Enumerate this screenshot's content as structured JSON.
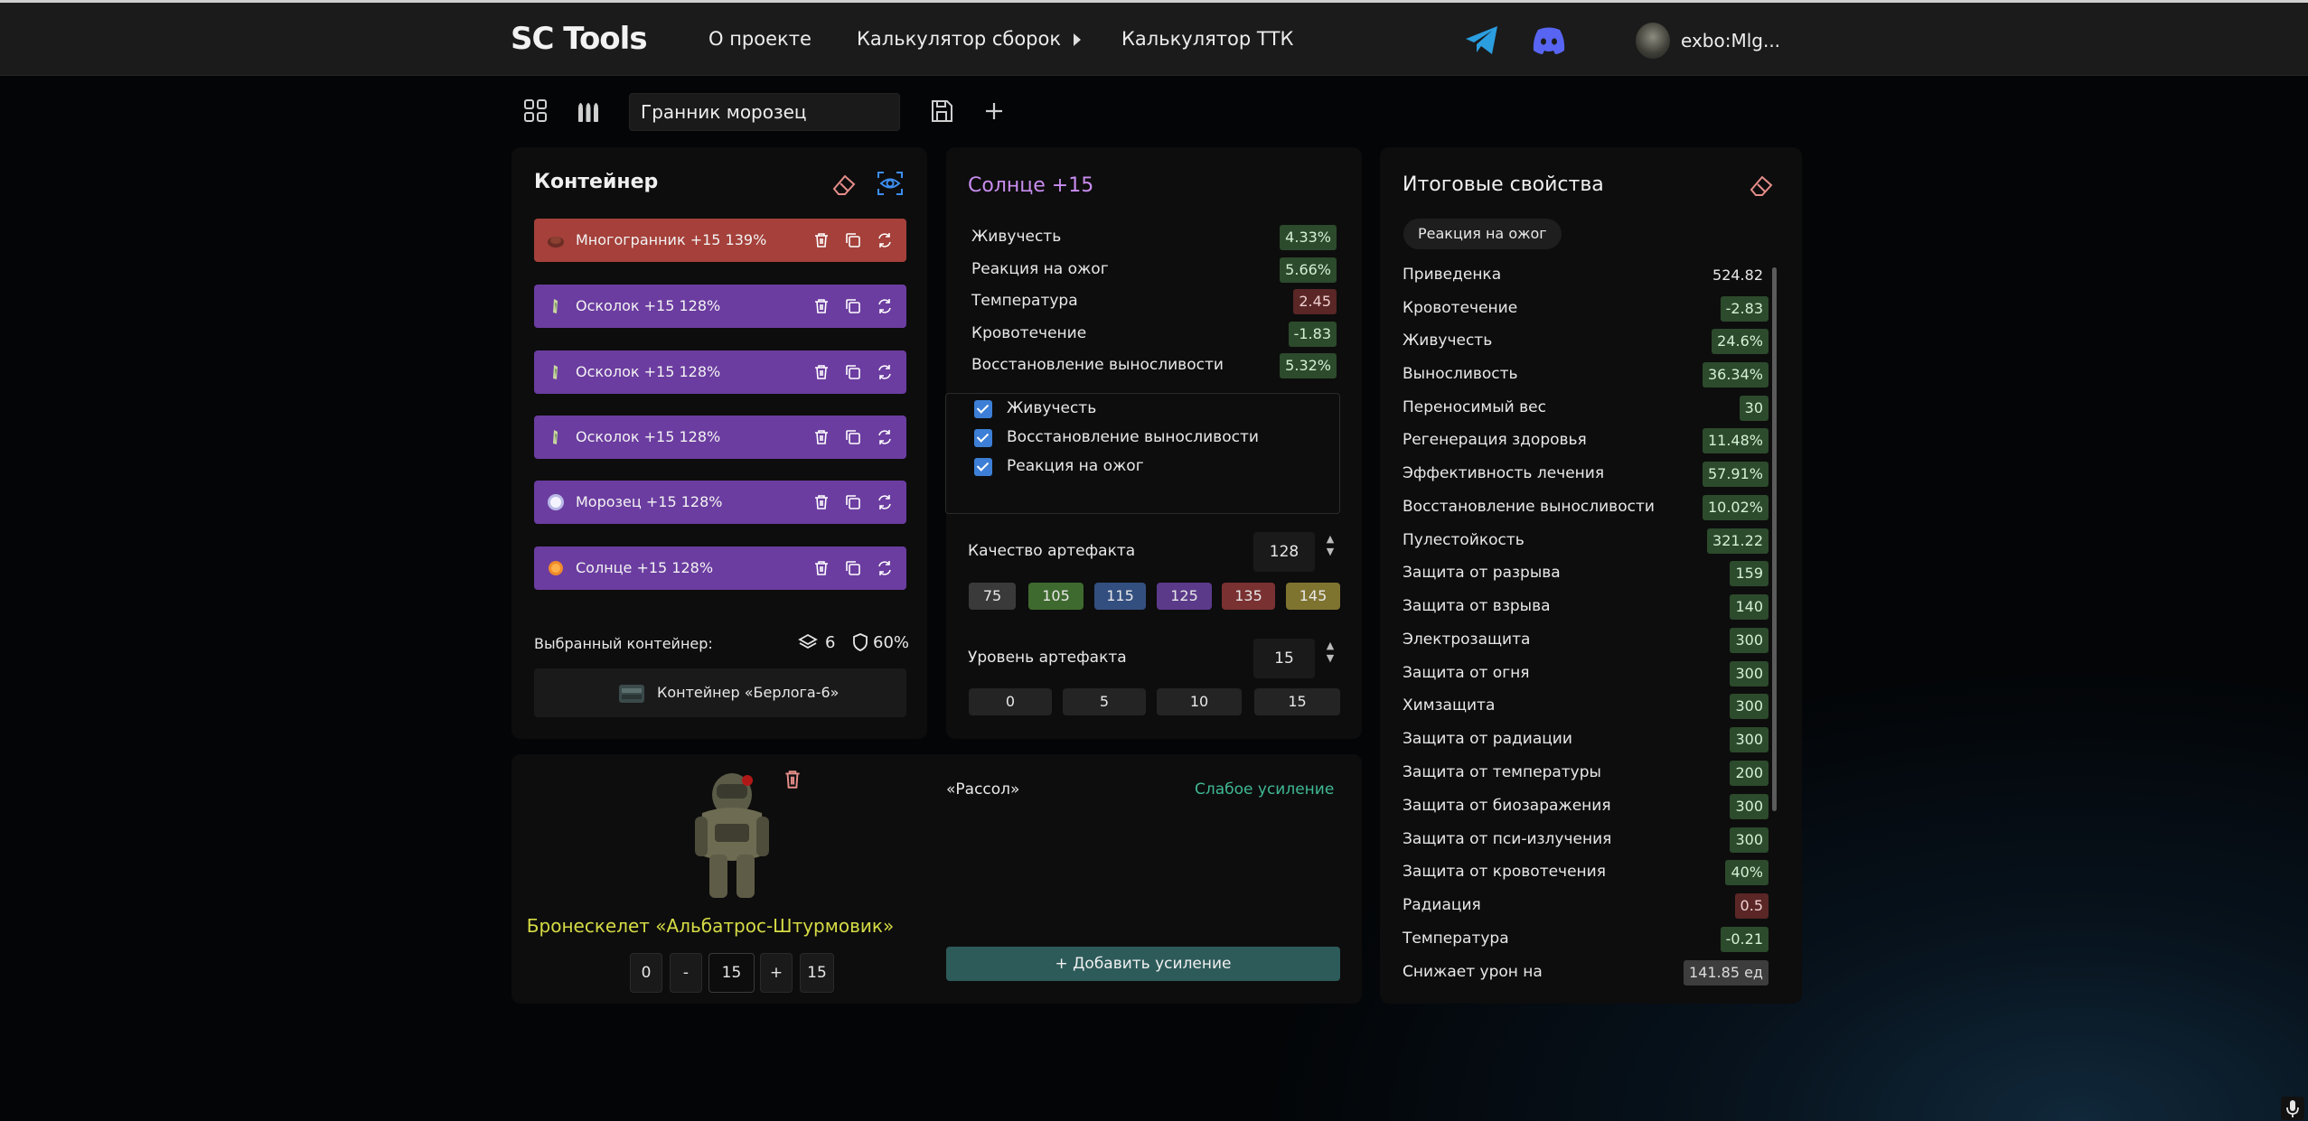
{
  "header": {
    "logo": "SC Tools",
    "nav": [
      "О проекте",
      "Калькулятор сборок",
      "Калькулятор ТТК"
    ],
    "user_name": "exbo:Mlg..."
  },
  "toolbar": {
    "build_name": "Гранник морозец"
  },
  "container_panel": {
    "title": "Контейнер",
    "items": [
      {
        "label": "Многогранник +15 139%",
        "color": "#a5403a",
        "icon": "polyhedron-artifact-icon"
      },
      {
        "label": "Осколок +15 128%",
        "color": "#6b3da0",
        "icon": "shard-artifact-icon"
      },
      {
        "label": "Осколок +15 128%",
        "color": "#6b3da0",
        "icon": "shard-artifact-icon"
      },
      {
        "label": "Осколок +15 128%",
        "color": "#6b3da0",
        "icon": "shard-artifact-icon"
      },
      {
        "label": "Морозец +15 128%",
        "color": "#6b3da0",
        "icon": "frost-artifact-icon"
      },
      {
        "label": "Солнце +15 128%",
        "color": "#6b3da0",
        "icon": "sun-artifact-icon"
      }
    ],
    "selected_label": "Выбранный контейнер:",
    "slots": "6",
    "protection": "60%",
    "container_name": "Контейнер «Берлога-6»"
  },
  "artifact_panel": {
    "title": "Солнце +15",
    "stats": [
      {
        "name": "Живучесть",
        "value": "4.33%",
        "tone": "green"
      },
      {
        "name": "Реакция на ожог",
        "value": "5.66%",
        "tone": "green"
      },
      {
        "name": "Температура",
        "value": "2.45",
        "tone": "red"
      },
      {
        "name": "Кровотечение",
        "value": "-1.83",
        "tone": "green"
      },
      {
        "name": "Восстановление выносливости",
        "value": "5.32%",
        "tone": "green"
      }
    ],
    "checkboxes": [
      "Живучесть",
      "Восстановление выносливости",
      "Реакция на ожог"
    ],
    "quality_label": "Качество артефакта",
    "quality_value": "128",
    "quality_presets": [
      {
        "label": "75",
        "color": "#3a3a3a"
      },
      {
        "label": "105",
        "color": "#3f6a2f"
      },
      {
        "label": "115",
        "color": "#334f80"
      },
      {
        "label": "125",
        "color": "#5b3a8a"
      },
      {
        "label": "135",
        "color": "#7a3131"
      },
      {
        "label": "145",
        "color": "#7f7330"
      }
    ],
    "level_label": "Уровень артефакта",
    "level_value": "15",
    "level_presets": [
      "0",
      "5",
      "10",
      "15"
    ]
  },
  "totals_panel": {
    "title": "Итоговые свойства",
    "filter_chip": "Реакция на ожог",
    "props": [
      {
        "name": "Приведенка",
        "value": "524.82",
        "tone": "plain"
      },
      {
        "name": "Кровотечение",
        "value": "-2.83",
        "tone": "green"
      },
      {
        "name": "Живучесть",
        "value": "24.6%",
        "tone": "green"
      },
      {
        "name": "Выносливость",
        "value": "36.34%",
        "tone": "green"
      },
      {
        "name": "Переносимый вес",
        "value": "30",
        "tone": "green"
      },
      {
        "name": "Регенерация здоровья",
        "value": "11.48%",
        "tone": "green"
      },
      {
        "name": "Эффективность лечения",
        "value": "57.91%",
        "tone": "green"
      },
      {
        "name": "Восстановление выносливости",
        "value": "10.02%",
        "tone": "green"
      },
      {
        "name": "Пулестойкость",
        "value": "321.22",
        "tone": "green"
      },
      {
        "name": "Защита от разрыва",
        "value": "159",
        "tone": "green"
      },
      {
        "name": "Защита от взрыва",
        "value": "140",
        "tone": "green"
      },
      {
        "name": "Электрозащита",
        "value": "300",
        "tone": "green"
      },
      {
        "name": "Защита от огня",
        "value": "300",
        "tone": "green"
      },
      {
        "name": "Химзащита",
        "value": "300",
        "tone": "green"
      },
      {
        "name": "Защита от радиации",
        "value": "300",
        "tone": "green"
      },
      {
        "name": "Защита от температуры",
        "value": "200",
        "tone": "green"
      },
      {
        "name": "Защита от биозаражения",
        "value": "300",
        "tone": "green"
      },
      {
        "name": "Защита от пси-излучения",
        "value": "300",
        "tone": "green"
      },
      {
        "name": "Защита от кровотечения",
        "value": "40%",
        "tone": "green"
      },
      {
        "name": "Радиация",
        "value": "0.5",
        "tone": "red"
      },
      {
        "name": "Температура",
        "value": "-0.21",
        "tone": "green"
      },
      {
        "name": "Снижает урон на",
        "value": "141.85 ед",
        "tone": "gray"
      }
    ]
  },
  "armor_panel": {
    "name": "Бронескелет «Альбатрос-Штурмовик»",
    "stepper": {
      "min": "0",
      "minus": "-",
      "value": "15",
      "plus": "+",
      "max": "15"
    },
    "upgrade_name": "«Рассол»",
    "upgrade_tier": "Слабое усиление",
    "add_label": "+ Добавить усиление"
  },
  "colors": {
    "accent_purple": "#c98df0",
    "accent_teal": "#3fb893",
    "armor_name": "#d6dc45"
  }
}
